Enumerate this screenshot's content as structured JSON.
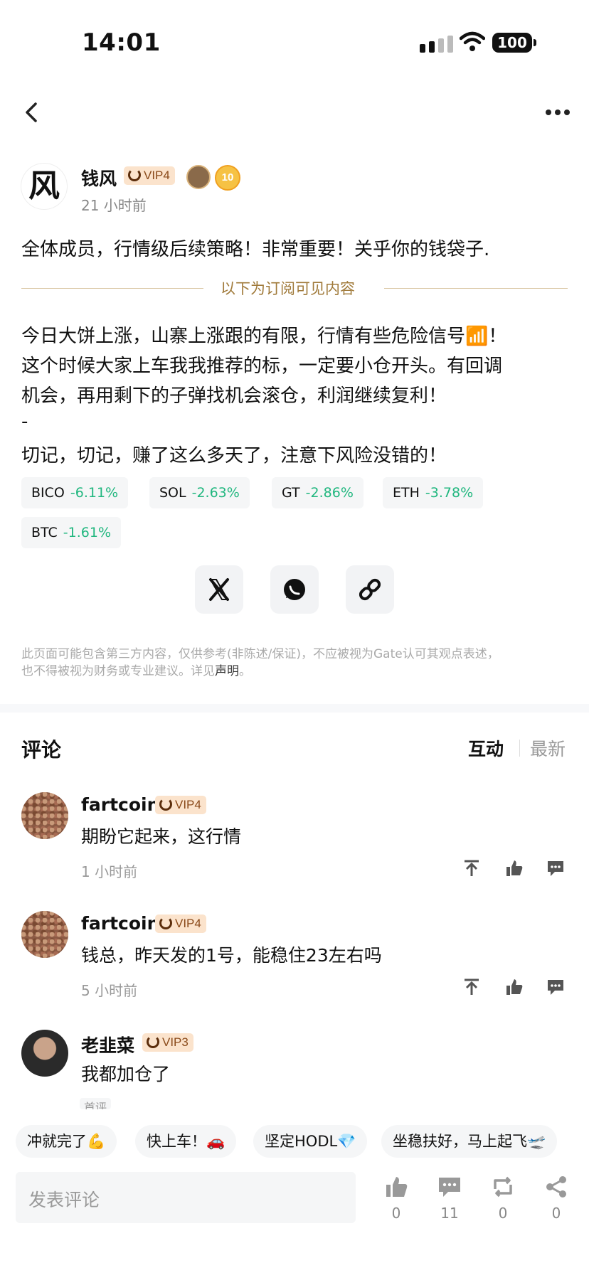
{
  "status_bar": {
    "time": "14:01",
    "battery": "100"
  },
  "author": {
    "avatar_char": "风",
    "name": "钱风",
    "vip": "VIP4",
    "level": "10",
    "time": "21 小时前"
  },
  "post": {
    "title": "全体成员，行情级后续策略！非常重要！关乎你的钱袋子.",
    "subscribe_label": "以下为订阅可见内容",
    "lines": [
      "今日大饼上涨，山寨上涨跟的有限，行情有些危险信号📶！",
      "这个时候大家上车我我推荐的标，一定要小仓开头。有回调",
      "机会，再用剩下的子弹找机会滚仓，利润继续复利！",
      "-",
      "切记，切记，赚了这么多天了，注意下风险没错的！"
    ],
    "tickers": [
      {
        "symbol": "BICO",
        "change": "-6.11%"
      },
      {
        "symbol": "SOL",
        "change": "-2.63%"
      },
      {
        "symbol": "GT",
        "change": "-2.86%"
      },
      {
        "symbol": "ETH",
        "change": "-3.78%"
      },
      {
        "symbol": "BTC",
        "change": "-1.61%"
      }
    ],
    "disclaimer_1": "此页面可能包含第三方内容，仅供参考(非陈述/保证)，不应被视为Gate认可其观点表述，",
    "disclaimer_2": "也不得被视为财务或专业建议。详见",
    "disclaimer_link": "声明",
    "disclaimer_end": "。"
  },
  "comments": {
    "title": "评论",
    "tab_interact": "互动",
    "tab_latest": "最新",
    "items": [
      {
        "name": "fartcoin",
        "vip": "VIP4",
        "text": "期盼它起来，这行情",
        "time": "1 小时前"
      },
      {
        "name": "fartcoin",
        "vip": "VIP4",
        "text": "钱总，昨天发的1号，能稳住23左右吗",
        "time": "5 小时前"
      },
      {
        "name": "老韭菜",
        "vip": "VIP3",
        "text": "我都加仓了",
        "time": "首评"
      }
    ]
  },
  "quick_replies": [
    "冲就完了💪",
    "快上车！🚗",
    "坚定HODL💎",
    "坐稳扶好，马上起飞🛫"
  ],
  "bottom_bar": {
    "placeholder": "发表评论",
    "likes": "0",
    "comments": "11",
    "reposts": "0",
    "shares": "0"
  },
  "colors": {
    "accent_green": "#21b77f",
    "vip_bg": "#fbe3cc",
    "subscribe_gold": "#a07a3a"
  }
}
